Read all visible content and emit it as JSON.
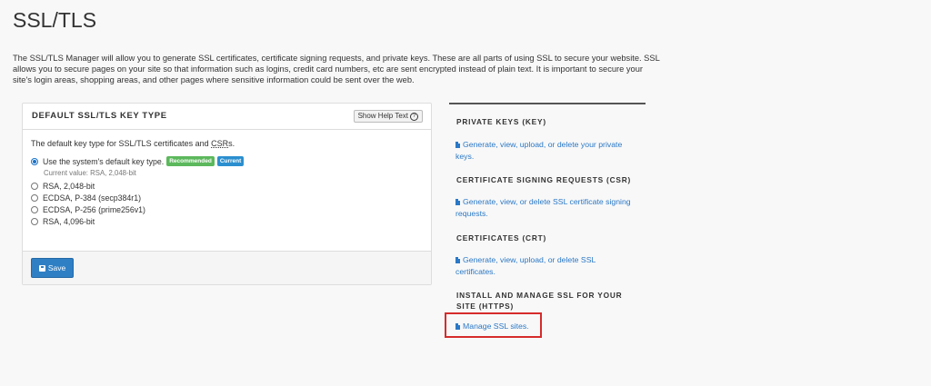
{
  "page": {
    "title": "SSL/TLS",
    "intro": "The SSL/TLS Manager will allow you to generate SSL certificates, certificate signing requests, and private keys. These are all parts of using SSL to secure your website. SSL allows you to secure pages on your site so that information such as logins, credit card numbers, etc are sent encrypted instead of plain text. It is important to secure your site's login areas, shopping areas, and other pages where sensitive information could be sent over the web."
  },
  "key_type_panel": {
    "title": "DEFAULT SSL/TLS KEY TYPE",
    "help_button": "Show Help Text",
    "description_prefix": "The default key type for SSL/TLS certificates and ",
    "description_abbr": "CSR",
    "description_suffix": "s.",
    "options": [
      {
        "label": "Use the system's default key type.",
        "checked": true
      },
      {
        "label": "RSA, 2,048-bit",
        "checked": false
      },
      {
        "label": "ECDSA, P-384 (secp384r1)",
        "checked": false
      },
      {
        "label": "ECDSA, P-256 (prime256v1)",
        "checked": false
      },
      {
        "label": "RSA, 4,096-bit",
        "checked": false
      }
    ],
    "badges": {
      "recommended": "Recommended",
      "current": "Current"
    },
    "current_value": "Current value: RSA, 2,048-bit",
    "save_button": "Save"
  },
  "sidebar": {
    "sections": [
      {
        "title": "PRIVATE KEYS (KEY)",
        "link": "Generate, view, upload, or delete your private keys."
      },
      {
        "title": "CERTIFICATE SIGNING REQUESTS (CSR)",
        "link": "Generate, view, or delete SSL certificate signing requests."
      },
      {
        "title": "CERTIFICATES (CRT)",
        "link": "Generate, view, upload, or delete SSL certificates."
      },
      {
        "title": "INSTALL AND MANAGE SSL FOR YOUR SITE (HTTPS)",
        "link": "Manage SSL sites."
      }
    ]
  },
  "colors": {
    "link": "#2a78c6",
    "accent": "#2f7fc4",
    "highlight": "#d62b2b",
    "recommended": "#5cb85c",
    "current": "#2b8fcf"
  }
}
